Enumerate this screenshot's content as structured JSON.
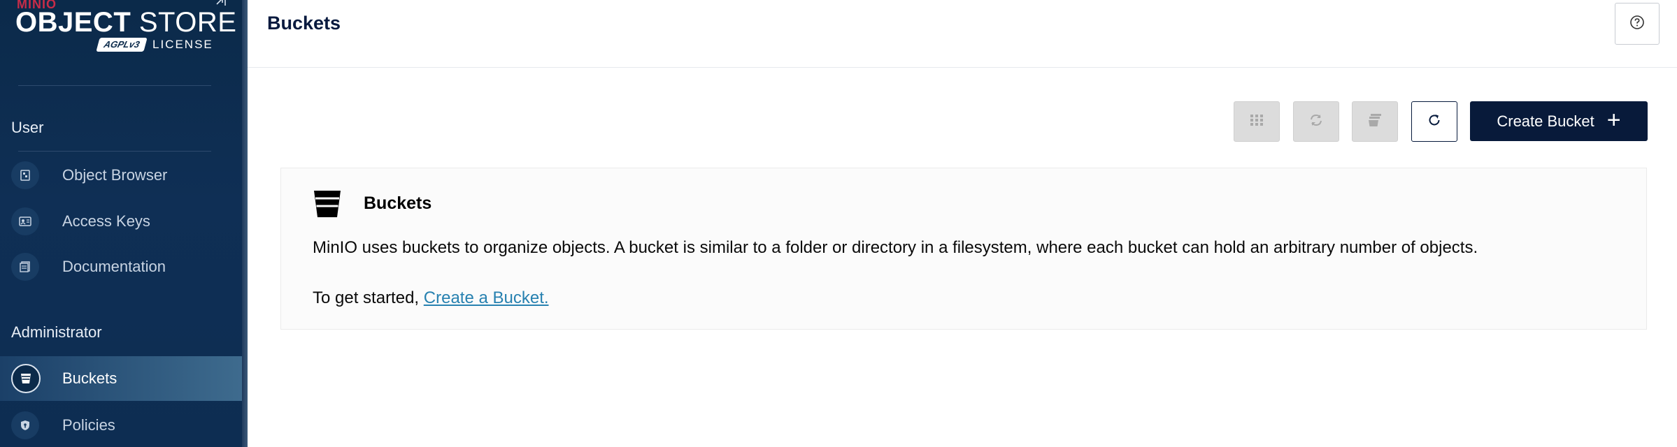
{
  "brand": {
    "top_wordmark": "MINIO",
    "product_bold": "OBJECT",
    "product_light": "STORE",
    "license_badge": "AGPLv3",
    "license_label": "LICENSE"
  },
  "sidebar": {
    "sections": [
      {
        "title": "User",
        "items": [
          {
            "label": "Object Browser",
            "icon": "object-browser-icon",
            "active": false
          },
          {
            "label": "Access Keys",
            "icon": "access-keys-icon",
            "active": false
          },
          {
            "label": "Documentation",
            "icon": "documentation-icon",
            "active": false
          }
        ]
      },
      {
        "title": "Administrator",
        "items": [
          {
            "label": "Buckets",
            "icon": "bucket-icon",
            "active": true
          },
          {
            "label": "Policies",
            "icon": "policies-icon",
            "active": false
          }
        ]
      }
    ]
  },
  "header": {
    "title": "Buckets",
    "help_icon": "help-circle-icon"
  },
  "toolbar": {
    "buttons": [
      {
        "icon": "grid-icon",
        "enabled": false
      },
      {
        "icon": "replication-icon",
        "enabled": false
      },
      {
        "icon": "batch-delete-icon",
        "enabled": false
      },
      {
        "icon": "refresh-icon",
        "enabled": true
      }
    ],
    "create_label": "Create Bucket"
  },
  "info_panel": {
    "title": "Buckets",
    "description": "MinIO uses buckets to organize objects. A bucket is similar to a folder or directory in a filesystem, where each bucket can hold an arbitrary number of objects.",
    "cta_prefix": "To get started, ",
    "cta_link": "Create a Bucket."
  },
  "colors": {
    "sidebar_bg": "#0b2a4a",
    "primary": "#081a3a",
    "link": "#2781b0",
    "brand_red": "#c72c48"
  }
}
